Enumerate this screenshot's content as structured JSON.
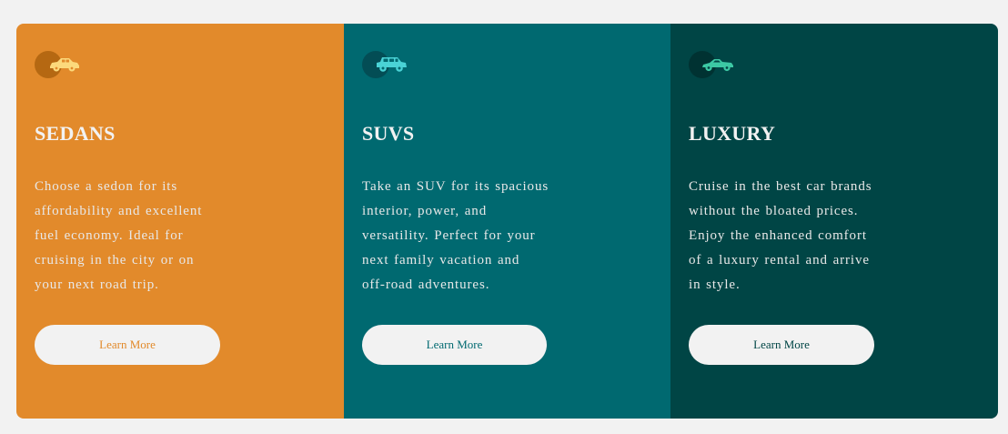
{
  "cards": [
    {
      "title": "SEDANS",
      "description_lines": [
        "Choose a sedon for its",
        "affordability and excellent",
        "fuel economy. Ideal for",
        "cruising in the city or on",
        "your next road trip."
      ],
      "button_label": "Learn More",
      "icon": "sedan-car-icon",
      "background": "#e28a2b",
      "accent": "#e28a2b",
      "icon_color": "#fcd97c",
      "icon_circle": "#b56812"
    },
    {
      "title": "SUVS",
      "description_lines": [
        "Take an SUV for its spacious",
        "interior, power, and",
        "versatility. Perfect for your",
        "next family vacation and",
        "off-road adventures."
      ],
      "button_label": "Learn More",
      "icon": "suv-car-icon",
      "background": "#006970",
      "accent": "#006970",
      "icon_color": "#4ad3d6",
      "icon_circle": "#034d55"
    },
    {
      "title": "LUXURY",
      "description_lines": [
        "Cruise in the best car brands",
        "without the bloated prices.",
        "Enjoy the enhanced comfort",
        "of a luxury rental and arrive",
        "in style."
      ],
      "button_label": "Learn More",
      "icon": "luxury-car-icon",
      "background": "#004545",
      "accent": "#004545",
      "icon_color": "#3cc8a4",
      "icon_circle": "#003232"
    }
  ]
}
